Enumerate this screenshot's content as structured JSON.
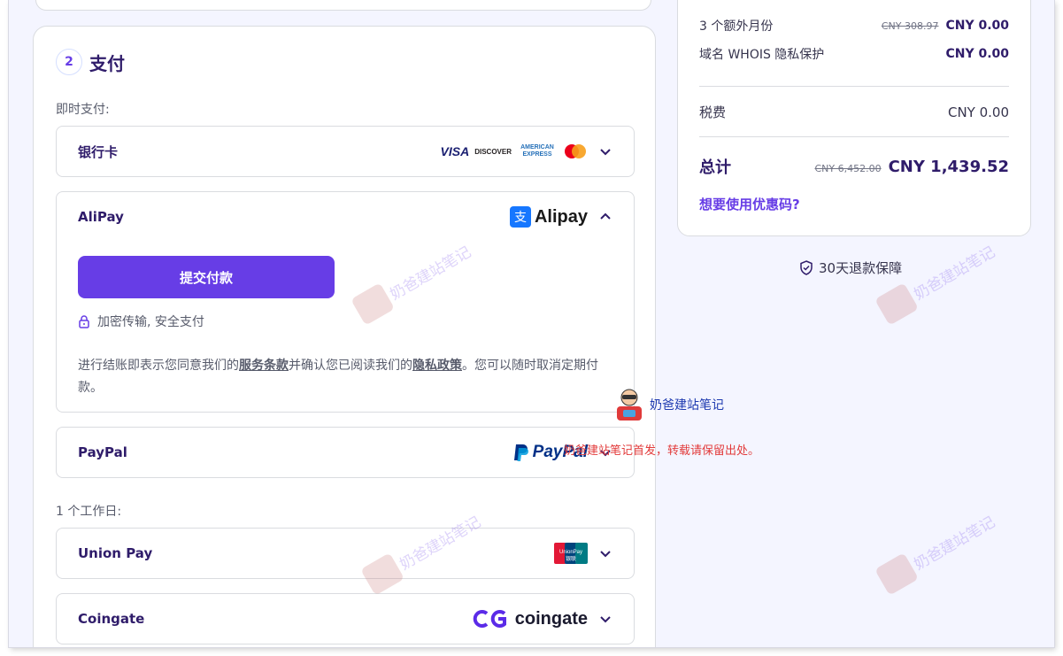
{
  "payment": {
    "step_number": "2",
    "title": "支付",
    "instant_label": "即时支付:",
    "workday_label": "1 个工作日:",
    "methods": [
      {
        "name": "银行卡",
        "logos": [
          "VISA",
          "DISCOVER",
          "AMERICAN EXPRESS",
          "mastercard"
        ]
      },
      {
        "name": "AliPay",
        "logo": "Alipay"
      },
      {
        "name": "PayPal",
        "logo": "PayPal"
      },
      {
        "name": "Union Pay",
        "logo": "UnionPay 银联"
      },
      {
        "name": "Coingate",
        "logo": "coingate"
      }
    ],
    "alipay": {
      "submit_label": "提交付款",
      "secure_text": "加密传输, 安全支付",
      "terms_prefix": "进行结账即表示您同意我们的",
      "terms_link": "服务条款",
      "terms_mid": "并确认您已阅读我们的",
      "privacy_link": "隐私政策",
      "terms_suffix": "。您可以随时取消定期付款。"
    }
  },
  "summary": {
    "rows": [
      {
        "label": "3 个额外月份",
        "old": "CNY 308.97",
        "now": "CNY 0.00"
      },
      {
        "label": "域名 WHOIS 隐私保护",
        "old": "",
        "now": "CNY 0.00"
      }
    ],
    "tax_label": "税费",
    "tax_value": "CNY 0.00",
    "total_label": "总计",
    "total_old": "CNY 6,452.00",
    "total_now": "CNY 1,439.52",
    "coupon_label": "想要使用优惠码?"
  },
  "guarantee": "30天退款保障",
  "watermark": {
    "text": "奶爸建站笔记",
    "notice": "奶爸建站笔记首发，转载请保留出处。"
  },
  "colors": {
    "primary": "#673de6",
    "heading": "#2f1c6a",
    "background": "#f4f5ff",
    "notice": "#e23a3a"
  }
}
